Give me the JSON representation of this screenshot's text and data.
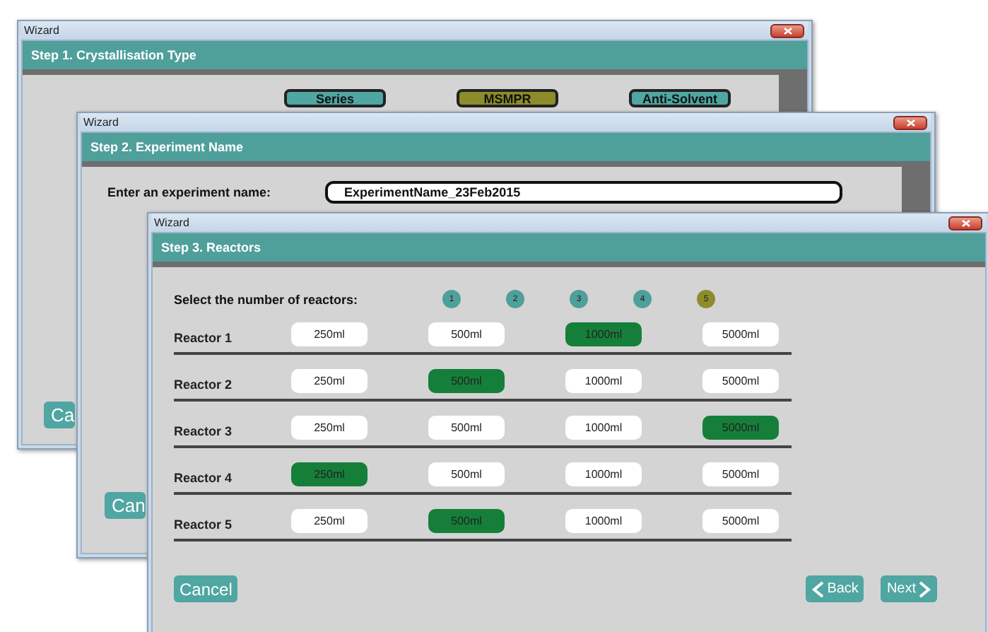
{
  "windows": [
    {
      "kind": "type",
      "title": "Wizard",
      "step": "Step 1. Crystallisation Type",
      "options": [
        {
          "label": "Series",
          "selected": false
        },
        {
          "label": "MSMPR",
          "selected": true
        },
        {
          "label": "Anti-Solvent",
          "selected": false
        }
      ],
      "cancel": "Ca"
    },
    {
      "kind": "name",
      "title": "Wizard",
      "step": "Step 2. Experiment Name",
      "prompt": "Enter an experiment name:",
      "value": "ExperimentName_23Feb2015",
      "cancel": "Can"
    },
    {
      "kind": "reactors",
      "title": "Wizard",
      "step": "Step 3. Reactors",
      "count_label": "Select the number of reactors:",
      "counts": [
        {
          "label": "1",
          "selected": false
        },
        {
          "label": "2",
          "selected": false
        },
        {
          "label": "3",
          "selected": false
        },
        {
          "label": "4",
          "selected": false
        },
        {
          "label": "5",
          "selected": true
        }
      ],
      "reactors": [
        {
          "name": "Reactor 1",
          "sizes": [
            {
              "label": "250ml",
              "selected": false
            },
            {
              "label": "500ml",
              "selected": false
            },
            {
              "label": "1000ml",
              "selected": true
            },
            {
              "label": "5000ml",
              "selected": false
            }
          ]
        },
        {
          "name": "Reactor 2",
          "sizes": [
            {
              "label": "250ml",
              "selected": false
            },
            {
              "label": "500ml",
              "selected": true
            },
            {
              "label": "1000ml",
              "selected": false
            },
            {
              "label": "5000ml",
              "selected": false
            }
          ]
        },
        {
          "name": "Reactor 3",
          "sizes": [
            {
              "label": "250ml",
              "selected": false
            },
            {
              "label": "500ml",
              "selected": false
            },
            {
              "label": "1000ml",
              "selected": false
            },
            {
              "label": "5000ml",
              "selected": true
            }
          ]
        },
        {
          "name": "Reactor 4",
          "sizes": [
            {
              "label": "250ml",
              "selected": true
            },
            {
              "label": "500ml",
              "selected": false
            },
            {
              "label": "1000ml",
              "selected": false
            },
            {
              "label": "5000ml",
              "selected": false
            }
          ]
        },
        {
          "name": "Reactor 5",
          "sizes": [
            {
              "label": "250ml",
              "selected": false
            },
            {
              "label": "500ml",
              "selected": true
            },
            {
              "label": "1000ml",
              "selected": false
            },
            {
              "label": "5000ml",
              "selected": false
            }
          ]
        }
      ],
      "cancel": "Cancel",
      "back": "Back",
      "next": "Next"
    }
  ]
}
